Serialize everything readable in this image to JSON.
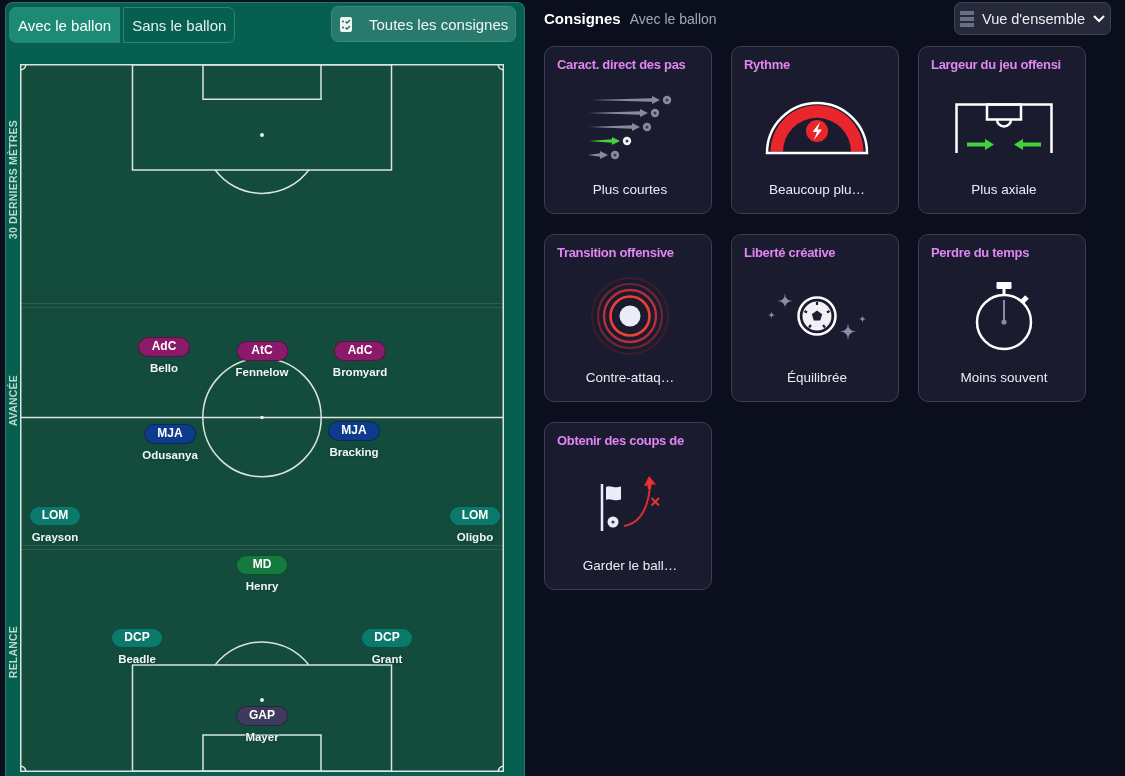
{
  "tabs": [
    {
      "label": "Avec le ballon",
      "selected": true
    },
    {
      "label": "Sans le ballon",
      "selected": false
    }
  ],
  "all_instructions_button": {
    "label": "Toutes les consignes"
  },
  "pitch": {
    "zones": [
      {
        "label": "30 DERNIERS MÈTRES"
      },
      {
        "label": "AVANCÉE"
      },
      {
        "label": "RELANCE"
      }
    ],
    "players": [
      {
        "role": "AdC",
        "name": "Bello",
        "color": "#8b1a6b"
      },
      {
        "role": "AtC",
        "name": "Fennelow",
        "color": "#8b1a6b"
      },
      {
        "role": "AdC",
        "name": "Bromyard",
        "color": "#8b1a6b"
      },
      {
        "role": "MJA",
        "name": "Odusanya",
        "color": "#0e3b8c"
      },
      {
        "role": "MJA",
        "name": "Bracking",
        "color": "#0e3b8c"
      },
      {
        "role": "LOM",
        "name": "Grayson",
        "color": "#0b7a6c"
      },
      {
        "role": "LOM",
        "name": "Oligbo",
        "color": "#0b7a6c"
      },
      {
        "role": "MD",
        "name": "Henry",
        "color": "#157a3f"
      },
      {
        "role": "DCP",
        "name": "Beadle",
        "color": "#0b7a6c"
      },
      {
        "role": "DCP",
        "name": "Grant",
        "color": "#0b7a6c"
      },
      {
        "role": "GAP",
        "name": "Mayer",
        "color": "#3e3a5e"
      }
    ]
  },
  "header": {
    "title": "Consignes",
    "subtitle": "Avec le ballon"
  },
  "view_dropdown": {
    "value": "Vue d'ensemble"
  },
  "cards": [
    {
      "kind": "passing",
      "title": "Caract. direct des pas",
      "value": "Plus courtes"
    },
    {
      "kind": "tempo",
      "title": "Rythme",
      "value": "Beaucoup plu…"
    },
    {
      "kind": "width",
      "title": "Largeur du jeu offensi",
      "value": "Plus axiale"
    },
    {
      "kind": "transition",
      "title": "Transition offensive",
      "value": "Contre-attaq…"
    },
    {
      "kind": "creative",
      "title": "Liberté créative",
      "value": "Équilibrée"
    },
    {
      "kind": "time-wasting",
      "title": "Perdre du temps",
      "value": "Moins souvent"
    },
    {
      "kind": "set-pieces",
      "title": "Obtenir des coups de",
      "value": "Garder le ball…"
    }
  ]
}
